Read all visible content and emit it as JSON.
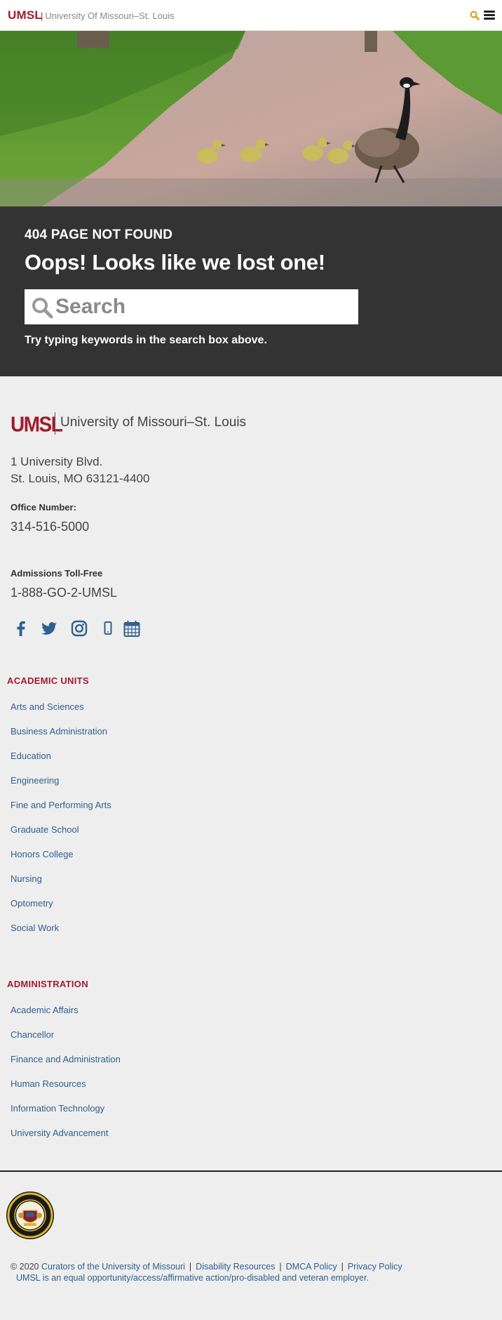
{
  "header": {
    "brand": "UMSL",
    "separator": "|",
    "subtitle": "University Of Missouri–St. Louis",
    "search_icon": "search-icon",
    "menu_icon": "hamburger-menu-icon"
  },
  "hero": {
    "image": "goose-and-goslings-on-path-photo"
  },
  "not_found": {
    "code": "404 PAGE NOT FOUND",
    "title": "Oops! Looks like we lost one!",
    "search_placeholder": "Search",
    "search_value": "",
    "hint": "Try typing keywords in the search box above."
  },
  "footer": {
    "logo_text": "UMSL",
    "university_name": "University of Missouri–St. Louis",
    "address_line1": "1 University Blvd.",
    "address_line2": "St. Louis, MO 63121-4400",
    "office_label": "Office Number:",
    "office_number": "314-516-5000",
    "admissions_label": "Admissions Toll-Free",
    "admissions_number": "1-888-GO-2-UMSL",
    "social": [
      "facebook-icon",
      "twitter-icon",
      "instagram-icon",
      "mobile-icon",
      "calendar-icon"
    ],
    "icon_color": "#2f5f8f",
    "academic_units": {
      "title": "ACADEMIC UNITS",
      "items": [
        "Arts and Sciences",
        "Business Administration",
        "Education",
        "Engineering",
        "Fine and Performing Arts",
        "Graduate School",
        "Honors College",
        "Nursing",
        "Optometry",
        "Social Work"
      ]
    },
    "administration": {
      "title": "ADMINISTRATION",
      "items": [
        "Academic Affairs",
        "Chancellor",
        "Finance and Administration",
        "Human Resources",
        "Information Technology",
        "University Advancement"
      ]
    },
    "seal_icon": "university-seal",
    "legal": {
      "copyright": "© 2020",
      "curators": "Curators of the University of Missouri",
      "disability": "Disability Resources",
      "dmca": "DMCA Policy",
      "privacy": "Privacy Policy",
      "pipe": "|",
      "eeo": "UMSL is an equal opportunity/access/affirmative action/pro-disabled and veteran employer."
    }
  },
  "colors": {
    "brand": "#a11c2d",
    "dark_band": "#333333",
    "link": "#2f5f8f",
    "page_bg": "#eeeeee"
  }
}
